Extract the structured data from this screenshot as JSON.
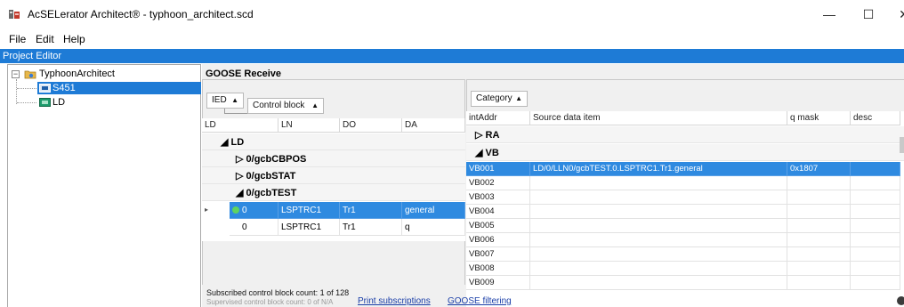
{
  "window": {
    "title": "AcSELerator Architect® - typhoon_architect.scd",
    "minimize_glyph": "—",
    "maximize_glyph": "☐",
    "close_glyph": "✕"
  },
  "menu": {
    "file": "File",
    "edit": "Edit",
    "help": "Help"
  },
  "project_editor": {
    "label": "Project Editor"
  },
  "tree": {
    "root": "TyphoonArchitect",
    "toggle_glyph": "−",
    "items": [
      {
        "label": "S451",
        "selected": true,
        "icon": "ied-device-icon"
      },
      {
        "label": "LD",
        "selected": false,
        "icon": "logical-device-icon"
      }
    ]
  },
  "goose_receive": {
    "title": "GOOSE Receive",
    "left": {
      "group_chips": {
        "ied": "IED",
        "control_block": "Control block",
        "sort_glyph": "▲"
      },
      "headers": [
        "LD",
        "LN",
        "DO",
        "DA"
      ],
      "groups": {
        "ld": "◢ LD",
        "cb1": "▷ 0/gcbCBPOS",
        "cb2": "▷ 0/gcbSTAT",
        "cb3": "◢ 0/gcbTEST"
      },
      "rows": [
        {
          "indicator": "▸",
          "ld": "0",
          "ln": "LSPTRC1",
          "do": "Tr1",
          "da": "general",
          "selected": true
        },
        {
          "indicator": "",
          "ld": "0",
          "ln": "LSPTRC1",
          "do": "Tr1",
          "da": "q",
          "selected": false
        }
      ]
    },
    "right": {
      "group_chip": "Category",
      "sort_glyph": "▲",
      "headers": [
        "intAddr",
        "Source data item",
        "q mask",
        "desc"
      ],
      "groups": {
        "ra": "▷ RA",
        "vb": "◢ VB"
      },
      "rows": [
        {
          "int_addr": "VB001",
          "source": "LD/0/LLN0/gcbTEST.0.LSPTRC1.Tr1.general",
          "q_mask": "0x1807",
          "desc": "",
          "selected": true
        },
        {
          "int_addr": "VB002",
          "source": "",
          "q_mask": "",
          "desc": "",
          "selected": false
        },
        {
          "int_addr": "VB003",
          "source": "",
          "q_mask": "",
          "desc": "",
          "selected": false
        },
        {
          "int_addr": "VB004",
          "source": "",
          "q_mask": "",
          "desc": "",
          "selected": false
        },
        {
          "int_addr": "VB005",
          "source": "",
          "q_mask": "",
          "desc": "",
          "selected": false
        },
        {
          "int_addr": "VB006",
          "source": "",
          "q_mask": "",
          "desc": "",
          "selected": false
        },
        {
          "int_addr": "VB007",
          "source": "",
          "q_mask": "",
          "desc": "",
          "selected": false
        },
        {
          "int_addr": "VB008",
          "source": "",
          "q_mask": "",
          "desc": "",
          "selected": false
        },
        {
          "int_addr": "VB009",
          "source": "",
          "q_mask": "",
          "desc": "",
          "selected": false
        }
      ]
    },
    "footer": {
      "subscribed": "Subscribed control block count: 1 of 128",
      "supervised": "Supervised control block count: 0 of N/A",
      "print_link": "Print subscriptions",
      "filter_link": "GOOSE filtering"
    }
  },
  "colors": {
    "accent": "#1e7bd6",
    "selection": "#2f8ae0",
    "link": "#1a3ea8"
  }
}
